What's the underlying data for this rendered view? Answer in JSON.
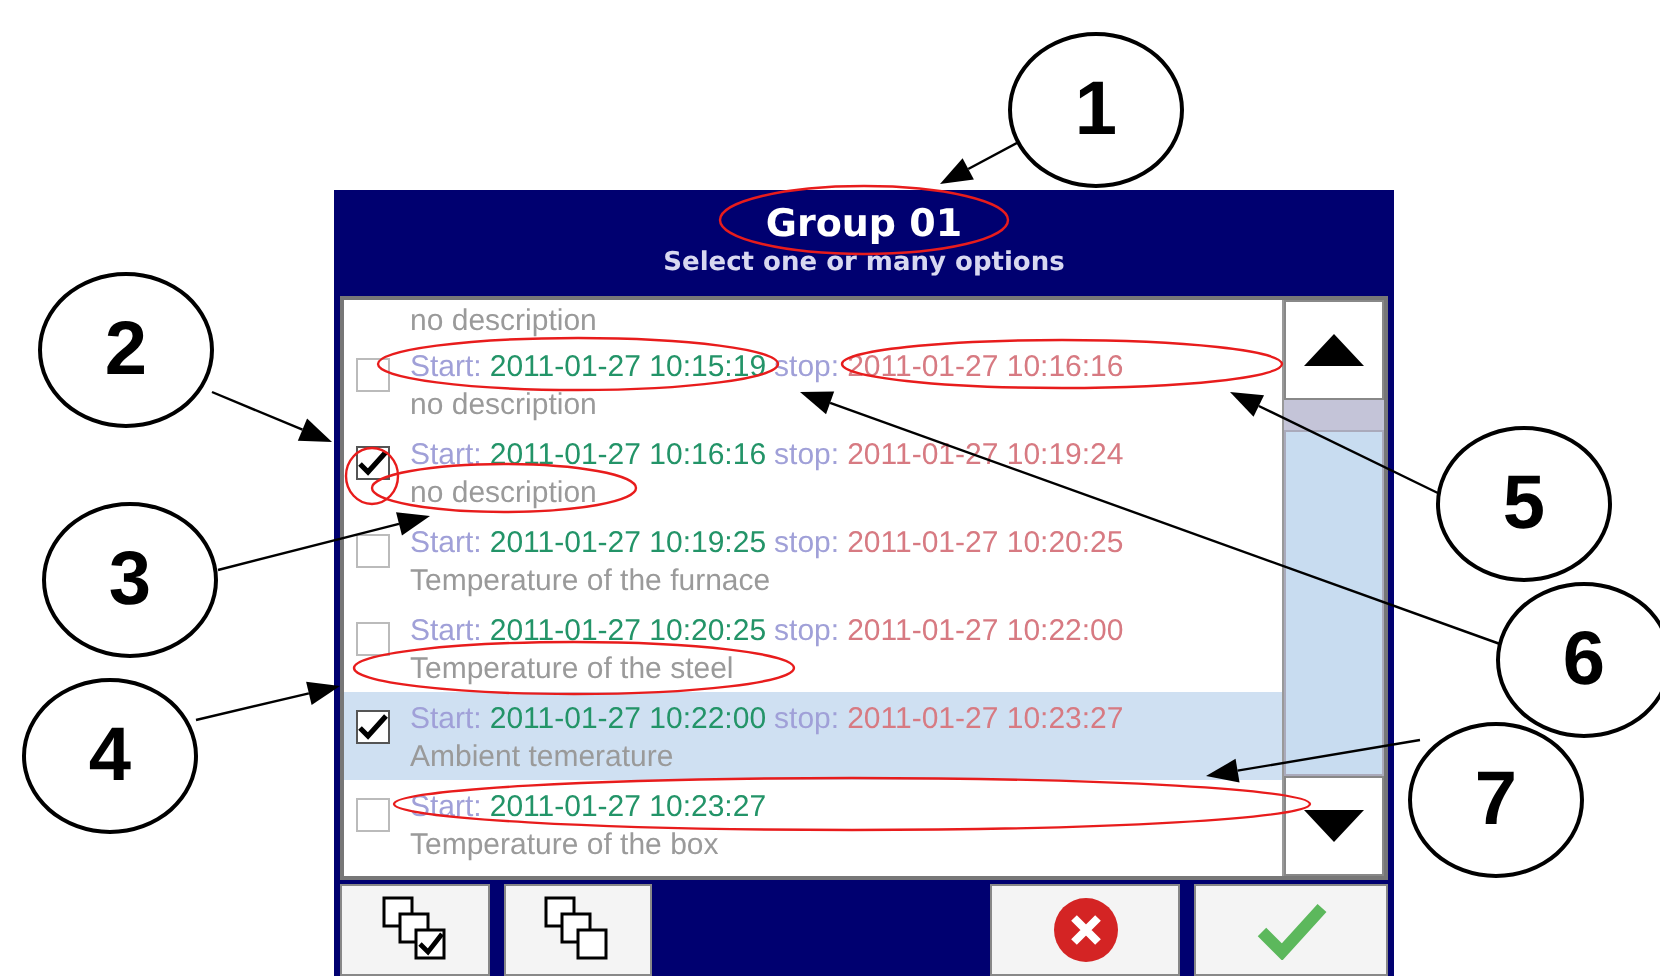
{
  "dialog": {
    "title": "Group 01",
    "subtitle": "Select one or many options"
  },
  "list": {
    "rows": [
      {
        "kind": "partial",
        "description": "no description",
        "selected": false
      },
      {
        "kind": "entry",
        "start_label": "Start:",
        "start": "2011-01-27 10:15:19",
        "stop_label": "stop:",
        "stop": "2011-01-27 10:16:16",
        "description": "no description",
        "checked": false,
        "selected": false
      },
      {
        "kind": "entry",
        "start_label": "Start:",
        "start": "2011-01-27 10:16:16",
        "stop_label": "stop:",
        "stop": "2011-01-27 10:19:24",
        "description": "no description",
        "checked": true,
        "selected": false
      },
      {
        "kind": "entry",
        "start_label": "Start:",
        "start": "2011-01-27 10:19:25",
        "stop_label": "stop:",
        "stop": "2011-01-27 10:20:25",
        "description": "Temperature of the furnace",
        "checked": false,
        "selected": false
      },
      {
        "kind": "entry",
        "start_label": "Start:",
        "start": "2011-01-27 10:20:25",
        "stop_label": "stop:",
        "stop": "2011-01-27 10:22:00",
        "description": "Temperature of the steel",
        "checked": false,
        "selected": false
      },
      {
        "kind": "entry",
        "start_label": "Start:",
        "start": "2011-01-27 10:22:00",
        "stop_label": "stop:",
        "stop": "2011-01-27 10:23:27",
        "description": "Ambient temerature",
        "checked": true,
        "selected": true
      },
      {
        "kind": "entry",
        "start_label": "Start:",
        "start": "2011-01-27 10:23:27",
        "description": "Temperature of the box",
        "checked": false,
        "selected": false
      }
    ]
  },
  "toolbar": [
    {
      "kind": "select_all"
    },
    {
      "kind": "deselect_all"
    },
    {
      "kind": "spacer"
    },
    {
      "kind": "cancel"
    },
    {
      "kind": "confirm"
    }
  ],
  "callouts": [
    {
      "number": "1"
    },
    {
      "number": "2"
    },
    {
      "number": "3"
    },
    {
      "number": "4"
    },
    {
      "number": "5"
    },
    {
      "number": "6"
    },
    {
      "number": "7"
    }
  ]
}
